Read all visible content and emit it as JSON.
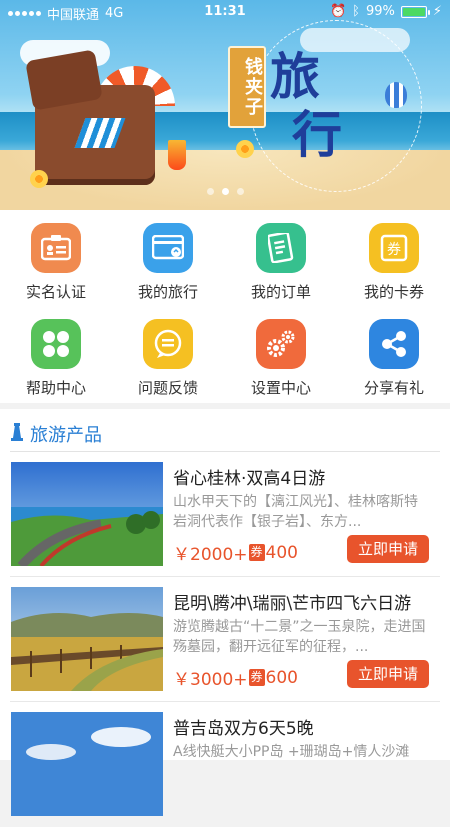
{
  "status": {
    "carrier": "中国联通",
    "network": "4G",
    "time": "11:31",
    "battery": "99%",
    "battery_level": 0.99
  },
  "banner": {
    "tag": "钱夹子",
    "title_line1": "旅",
    "title_line2": "行",
    "dots": 3,
    "active_dot": 1
  },
  "menu": [
    {
      "label": "实名认证",
      "icon": "id-card-icon",
      "color": "#f08a4f"
    },
    {
      "label": "我的旅行",
      "icon": "travel-card-icon",
      "color": "#3aa1ea"
    },
    {
      "label": "我的订单",
      "icon": "order-list-icon",
      "color": "#36c08e"
    },
    {
      "label": "我的卡券",
      "icon": "coupon-icon",
      "color": "#f5c022"
    },
    {
      "label": "帮助中心",
      "icon": "help-grid-icon",
      "color": "#57c25a"
    },
    {
      "label": "问题反馈",
      "icon": "feedback-chat-icon",
      "color": "#f5c022"
    },
    {
      "label": "设置中心",
      "icon": "settings-gear-icon",
      "color": "#f06a3c"
    },
    {
      "label": "分享有礼",
      "icon": "share-icon",
      "color": "#2e86e0"
    }
  ],
  "section": {
    "title": "旅游产品"
  },
  "products": [
    {
      "title": "省心桂林·双高4日游",
      "desc": "山水甲天下的【漓江风光】、桂林喀斯特岩洞代表作【银子岩】、东方...",
      "price": "￥2000+",
      "coupon": "券",
      "coupon_value": "400",
      "button": "立即申请"
    },
    {
      "title": "昆明\\腾冲\\瑞丽\\芒市四飞六日游",
      "desc": "游览腾越古“十二景”之一玉泉院，走进国殇墓园，翻开远征军的征程，...",
      "price": "￥3000+",
      "coupon": "券",
      "coupon_value": "600",
      "button": "立即申请"
    },
    {
      "title": "普吉岛双方6天5晚",
      "desc": "A线快艇大小PP岛 +珊瑚岛+情人沙滩",
      "price": "",
      "coupon": "",
      "coupon_value": "",
      "button": ""
    }
  ]
}
